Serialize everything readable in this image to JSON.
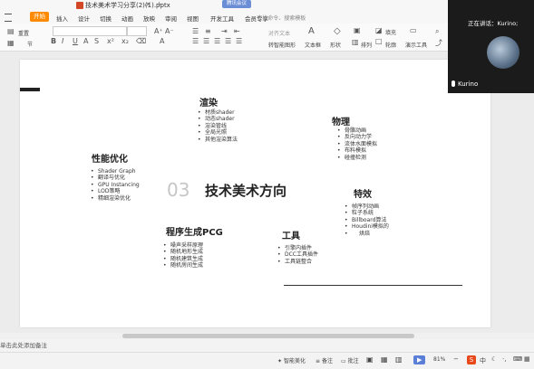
{
  "window": {
    "doc_title": "技术美术学习分享(2)(1).pptx",
    "close_glyph": "×",
    "record_badge": "腾讯会议",
    "add_tab": "+"
  },
  "menu": {
    "file": "开始",
    "items": [
      "插入",
      "设计",
      "切换",
      "动画",
      "放映",
      "审阅",
      "视图",
      "开发工具",
      "会员专享"
    ],
    "search": "查找命令、搜索模板"
  },
  "toolbar": {
    "reset": "重置",
    "section": "节",
    "font_size_placeholder": "对齐文本",
    "convert_smartart": "转智能图形",
    "textbox": "文本框",
    "shape": "形状",
    "arrange": "排列",
    "fill": "填充",
    "outline": "轮廓",
    "presenter_tools": "演示工具"
  },
  "slide": {
    "number": "03",
    "title": "技术美术方向",
    "sections": [
      {
        "title": "渲染",
        "items": [
          "材质shader",
          "动态shader",
          "渲染管线",
          "全局光照",
          "其他渲染算法"
        ]
      },
      {
        "title": "物理",
        "items": [
          "骨骼动画",
          "反向动力学",
          "流体水面模拟",
          "布料模拟",
          "碰撞检测"
        ]
      },
      {
        "title": "性能优化",
        "items": [
          "Shader Graph",
          "翻译与优化",
          "GPU Instancing",
          "LOD策略",
          "精细渲染优化"
        ]
      },
      {
        "title": "特效",
        "items": [
          "帧序列动画",
          "粒子系统",
          "Billboard算法",
          "Houdini模拟的",
          "烘焙"
        ]
      },
      {
        "title": "程序生成PCG",
        "items": [
          "噪声采样原理",
          "随机地形生成",
          "随机建筑生成",
          "随机房间生成"
        ]
      },
      {
        "title": "工具",
        "items": [
          "引擎内插件",
          "DCC工具插件",
          "工具链整合"
        ]
      }
    ]
  },
  "video": {
    "status": "正在讲话：Kurino;",
    "speaker": "Kurino"
  },
  "notes": {
    "placeholder": "单击此处添加备注"
  },
  "statusbar": {
    "smart_beautify": "智能美化",
    "notes": "备注",
    "comments": "批注",
    "zoom": "81%",
    "ime": "中"
  },
  "colors": {
    "file_button": "#ff8a00",
    "video_bg": "#1b1b1b",
    "wps_logo": "#e8481a"
  }
}
